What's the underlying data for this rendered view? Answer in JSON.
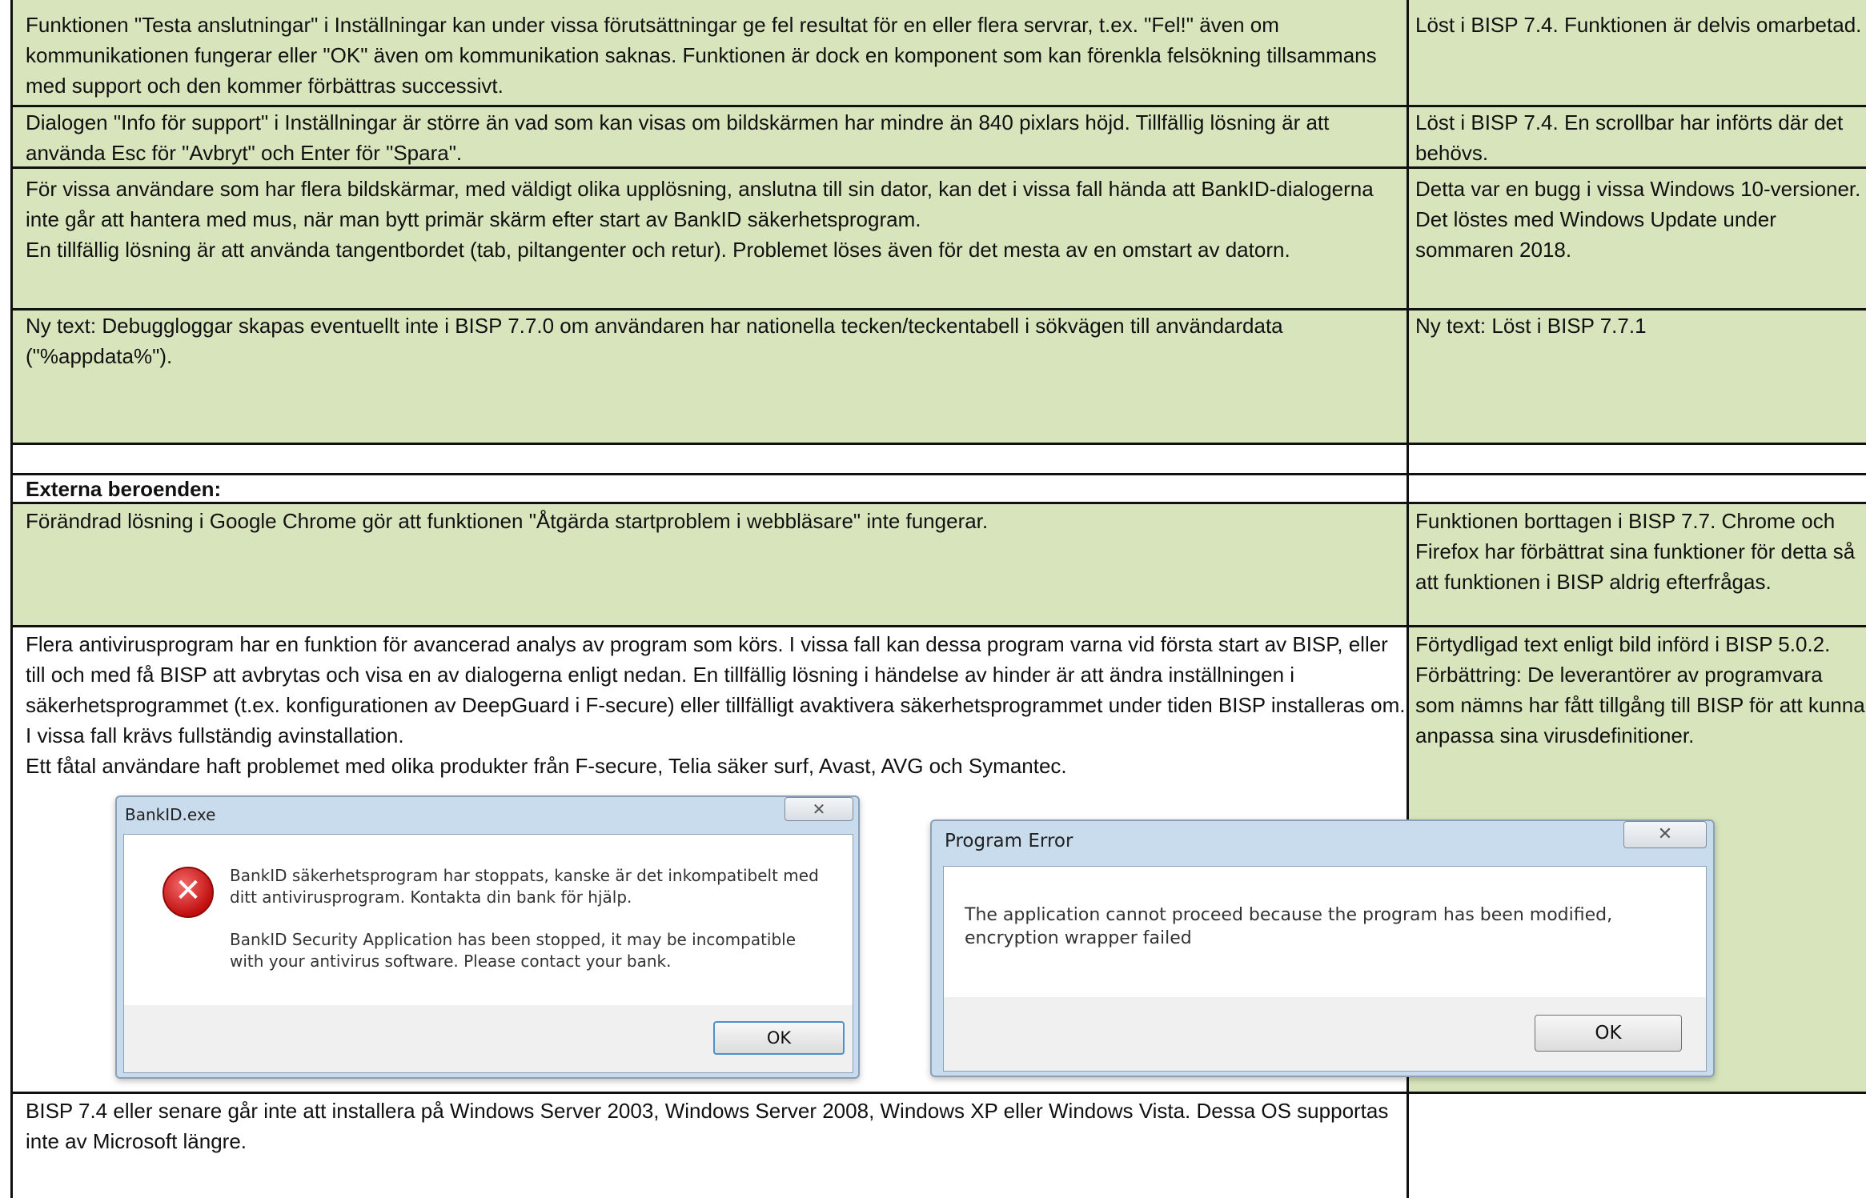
{
  "rows": [
    {
      "left": "Funktionen \"Testa anslutningar\" i Inställningar kan under vissa förutsättningar ge fel resultat för en eller flera servrar, t.ex. \"Fel!\" även om kommunikationen fungerar eller \"OK\" även om kommunikation saknas. Funktionen är dock en komponent som kan förenkla felsökning tillsammans med support och den kommer förbättras successivt.",
      "right": "Löst i BISP 7.4. Funktionen är delvis omarbetad."
    },
    {
      "left": "Dialogen \"Info för support\" i Inställningar är större än vad som kan visas om bildskärmen har mindre än 840 pixlars höjd. Tillfällig lösning är att använda Esc för \"Avbryt\" och Enter för \"Spara\".",
      "right": "Löst i BISP 7.4. En scrollbar har införts där det behövs."
    },
    {
      "left": "För vissa användare som har flera bildskärmar, med väldigt olika upplösning, anslutna till sin dator, kan det i vissa fall hända att BankID-dialogerna inte går att hantera med mus, när man bytt primär skärm efter start av BankID säkerhetsprogram.",
      "left_2": "En tillfällig lösning är att använda tangentbordet (tab, piltangenter och retur). Problemet löses även för det mesta av en omstart av datorn.",
      "right": "Detta var en bugg i vissa Windows 10-versioner. Det löstes med Windows Update under sommaren 2018."
    },
    {
      "left": "Ny text: Debuggloggar skapas eventuellt inte i BISP 7.7.0 om användaren har nationella tecken/teckentabell i sökvägen till användardata (\"%appdata%\").",
      "right": "Ny text: Löst i BISP 7.7.1"
    },
    {
      "left": "",
      "right": ""
    },
    {
      "left": "Externa beroenden:",
      "right": ""
    },
    {
      "left": "Förändrad lösning i Google Chrome gör att funktionen \"Åtgärda startproblem i webbläsare\" inte fungerar.",
      "right": "Funktionen borttagen i BISP 7.7. Chrome och Firefox har förbättrat sina funktioner för detta så att funktionen i BISP aldrig efterfrågas."
    },
    {
      "left": "Flera antivirusprogram har en funktion för avancerad analys av program som körs. I vissa fall kan dessa program varna vid första start av BISP, eller till och med få BISP att avbrytas och visa en av dialogerna enligt nedan. En tillfällig lösning i händelse av hinder är att ändra inställningen i säkerhetsprogrammet (t.ex. konfigurationen av DeepGuard i F-secure) eller tillfälligt avaktivera säkerhetsprogrammet under tiden BISP installeras om. I vissa fall krävs fullständig avinstallation.",
      "left_2": "Ett fåtal användare haft problemet med olika produkter från F-secure, Telia säker surf, Avast, AVG och Symantec.",
      "right": "Förtydligad text enligt bild införd i BISP 5.0.2. Förbättring: De leverantörer av programvara som nämns har fått tillgång till BISP för att kunna anpassa sina virusdefinitioner."
    },
    {
      "left": "BISP 7.4 eller senare går inte att installera på Windows Server 2003, Windows Server 2008, Windows XP eller Windows Vista. Dessa OS supportas inte av Microsoft längre.",
      "right": ""
    }
  ],
  "dialogs": {
    "bankid": {
      "title": "BankID.exe",
      "close": "✕",
      "msg_sv": "BankID säkerhetsprogram har stoppats, kanske är det inkompatibelt med ditt antivirusprogram. Kontakta din bank för hjälp.",
      "msg_en": "BankID Security Application has been stopped, it may be incompatible with your antivirus software. Please contact your bank.",
      "ok": "OK"
    },
    "program_error": {
      "title": "Program Error",
      "close": "✕",
      "msg": "The application cannot proceed because the program has been modified, encryption wrapper failed",
      "ok": "OK"
    }
  }
}
